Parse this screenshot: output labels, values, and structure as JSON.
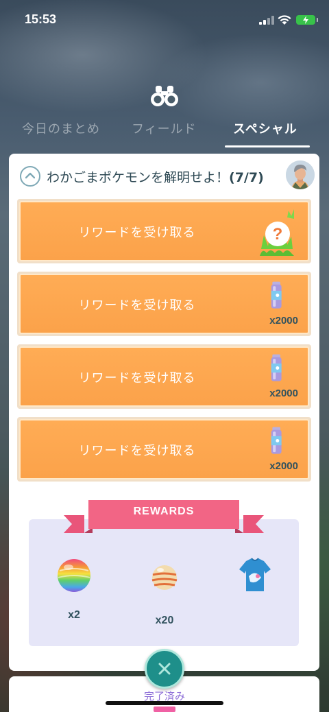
{
  "status_bar": {
    "time": "15:53"
  },
  "tabs": [
    {
      "label": "今日のまとめ",
      "active": false
    },
    {
      "label": "フィールド",
      "active": false
    },
    {
      "label": "スペシャル",
      "active": true
    }
  ],
  "research": {
    "title": "わかごまポケモンを解明せよ！",
    "progress": "(7/7)",
    "rewards": [
      {
        "label": "リワードを受け取る",
        "icon": "mystery-pokemon-encounter-icon",
        "qty": ""
      },
      {
        "label": "リワードを受け取る",
        "icon": "stardust-icon",
        "qty": "x2000"
      },
      {
        "label": "リワードを受け取る",
        "icon": "stardust-icon",
        "qty": "x2000"
      },
      {
        "label": "リワードを受け取る",
        "icon": "stardust-icon",
        "qty": "x2000"
      }
    ]
  },
  "final_rewards": {
    "banner": "REWARDS",
    "items": [
      {
        "icon": "rare-candy-icon",
        "qty": "x2"
      },
      {
        "icon": "pinap-berry-icon",
        "qty": "x20"
      },
      {
        "icon": "avatar-shirt-icon",
        "qty": ""
      }
    ]
  },
  "completed": {
    "label": "完了済み"
  },
  "colors": {
    "reward_button": "#fba24a",
    "rewards_box": "#e6e6f8",
    "ribbon": "#f26585",
    "complete_button": "#1e8f8a"
  }
}
